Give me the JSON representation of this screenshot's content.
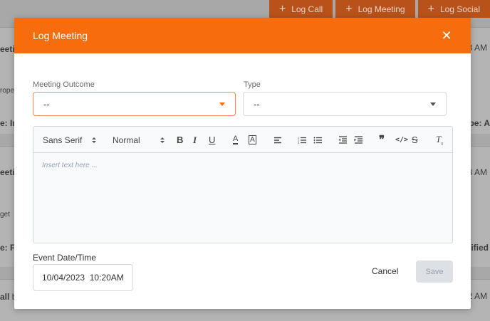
{
  "background": {
    "top_buttons": [
      {
        "icon": "plus-icon",
        "label": "Log Call"
      },
      {
        "icon": "plus-icon",
        "label": "Log Meeting"
      },
      {
        "icon": "plus-icon",
        "label": "Log Social"
      }
    ],
    "fragments": {
      "left_a": "eeti",
      "left_b": "rope",
      "left_c": "e: Int",
      "left_d": "eeti",
      "left_e": "get",
      "left_f": "e: Fo",
      "left_g": "all",
      "left_g2": "b",
      "right_a": "3 AM",
      "right_b": "pe: A",
      "right_c": "3 AM",
      "right_d": "ified",
      "right_e": "2 AM"
    }
  },
  "modal": {
    "title": "Log Meeting",
    "close_icon": "close-icon",
    "meeting_outcome": {
      "label": "Meeting Outcome",
      "value": "--"
    },
    "type": {
      "label": "Type",
      "value": "--"
    },
    "editor": {
      "font_family": "Sans Serif",
      "font_size": "Normal",
      "placeholder": "Insert text here ...",
      "tools": {
        "bold": "B",
        "italic": "I",
        "underline": "U",
        "text_color": "A",
        "highlight": "A",
        "align": "align-icon",
        "ordered_list": "ordered-list-icon",
        "bullet_list": "bullet-list-icon",
        "outdent": "outdent-icon",
        "indent": "indent-icon",
        "quote": "quote-icon",
        "code": "code-icon",
        "strike": "strike-icon",
        "clear_format": "clear-format-icon"
      }
    },
    "event_datetime": {
      "label": "Event Date/Time",
      "value": "10/04/2023  10:20AM"
    },
    "cancel_label": "Cancel",
    "save_label": "Save"
  },
  "colors": {
    "accent": "#f76c0c",
    "save_disabled_bg": "#dde1e6"
  }
}
